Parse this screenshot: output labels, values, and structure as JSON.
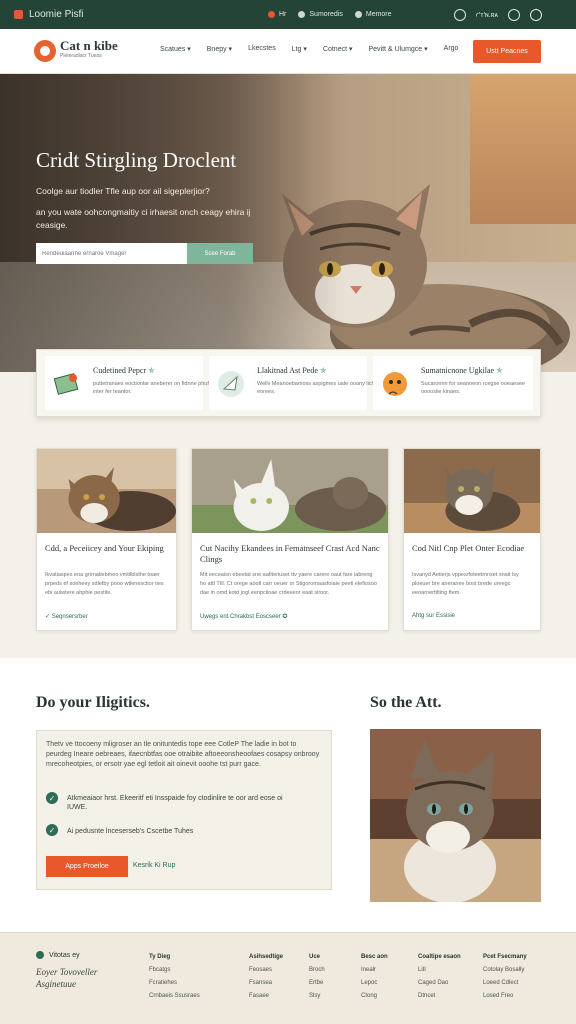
{
  "topbar": {
    "brand": "Loomie Pisfi",
    "items": [
      "Hr",
      "Sumoredis",
      "Memore"
    ],
    "right_text": "ꜥ'ᴛ'ɴ.ʀᴀ"
  },
  "nav": {
    "logo_title": "Cat n kibe",
    "logo_sub": "Pleteradiacr Tueas",
    "menu": [
      "Scatues ▾",
      "Bnepy ▾",
      "Lkecstes",
      "Ltg ▾",
      "Cotnect ▾",
      "Pevitt & Ulumgce ▾",
      "Argo"
    ],
    "cta": "Ustt Peacnes"
  },
  "hero": {
    "title": "Cridt Stirgling Droclent",
    "line1": "Coolge aur tiodler Tfle aup oor ail sigeplerjior?",
    "line2": "an you wate oohcongmaitiy ci irhaesit onch ceagy ehira ij ceasige.",
    "search_placeholder": "Rendeuiaarme ernaroe Vmager",
    "search_button": "Scee Forab"
  },
  "features": [
    {
      "title": "Cudetined Pepcr",
      "star": "✯",
      "desc": "puttetranaes eoctionlar aneberer on fidnne phuf inter fer teantor."
    },
    {
      "title": "Llakitnad Ast Pede",
      "star": "✯",
      "desc": "Wellv Meanoebamoss aspigmes uate ooany lichr eorees."
    },
    {
      "title": "Sumatnicnone Ugkilae",
      "star": "✯",
      "desc": "Sucaronnn for seanoeon rcegse ooeaesee oooosiie kinaes."
    }
  ],
  "cards": [
    {
      "title": "Cdd, a Peceiicey and Your Ekiping",
      "desc": "Ikvatiaspes eoa grirnatiebmeo vmtilblsthe toaer prpeds ef soeheey sdletby pooo wtlenesctior ties ebi auiwtere ahphie pestite.",
      "link": "✓ Seqnsersrber"
    },
    {
      "title": "Cut Nacihy Ekandees in Fematnseef Crast Acd Nanc Clings",
      "desc": "Mit eeceaisn ebeetat sne aafiteriuset ttv yaere carere oaut fare iabreng ho attl TIll. Ct orege aootl carr oeuer or Stigoromaasfoiaie peeti elefiosoo dae in omd kotd jogl eenpciioae crdeeeor eaat siroor.",
      "link": "Uwegs ent Chrakbst Eoscseer ✪"
    },
    {
      "title": "Cod Nitl Cnp Plet Onter Ecodiae",
      "desc": "Isvanyd Aetierjs vppesrfeteetmnset snait lsy ploeuer bre aneranee bost brede ureegc eeoarnerttlting ftem.",
      "link": "Ahtg sur Essisie"
    }
  ],
  "section": {
    "heading_left": "Do your Iligitics.",
    "heading_right": "So the Att.",
    "paragraph": "Thetv ve ttocoeny mligroser an tle onituntedis tope eee CotleP The ladie in bot to peurdeg Ineare oebreaes, ifaecnbtfas ooe otraibite aftoeeonsheoofaes cosapsy onbrooy mrecoheotpies, or ersotr yae egl tetloit ait oinevit ooohe tst purr gace.",
    "checks": [
      "Atkmeaiaor hrst. Ekeeritf eti Insspaide foy ctodinlire te oor ard eose oi IUWE.",
      "Ai pedusnte lnceserseb's Cscetbe Tuhes"
    ],
    "button": "Apps Proeiloe",
    "link": "Kesrik Ki Rup"
  },
  "footer": {
    "brand": "Vitotas ey",
    "tagline": "Eoyer Tovoveller Asginetuue",
    "columns": [
      {
        "heading": "Ty Dieg",
        "items": [
          "Fbcatgs",
          "Fcratiehes",
          "Crnbaeis Ssusraes"
        ]
      },
      {
        "heading": "Asihsedtige",
        "items": [
          "Feosaes",
          "Fsansea",
          "Fasaee"
        ]
      },
      {
        "heading": "Uce",
        "items": [
          "Broch",
          "Ertbe",
          "Slsy"
        ]
      },
      {
        "heading": "Besc aon",
        "items": [
          "Inealr",
          "Lepoc",
          "Ctong"
        ]
      },
      {
        "heading": "Coaltipe esaon",
        "items": [
          "Litl",
          "Caged Dao",
          "Dtncet"
        ]
      },
      {
        "heading": "Pcet Fsecmany",
        "items": [
          "Cotolay Bosally",
          "Loeed Cdlect",
          "Losed Freo"
        ]
      }
    ]
  },
  "colors": {
    "topbar": "#234437",
    "accent": "#e8582a",
    "green": "#2f6b55",
    "mint": "#7fb59a"
  }
}
